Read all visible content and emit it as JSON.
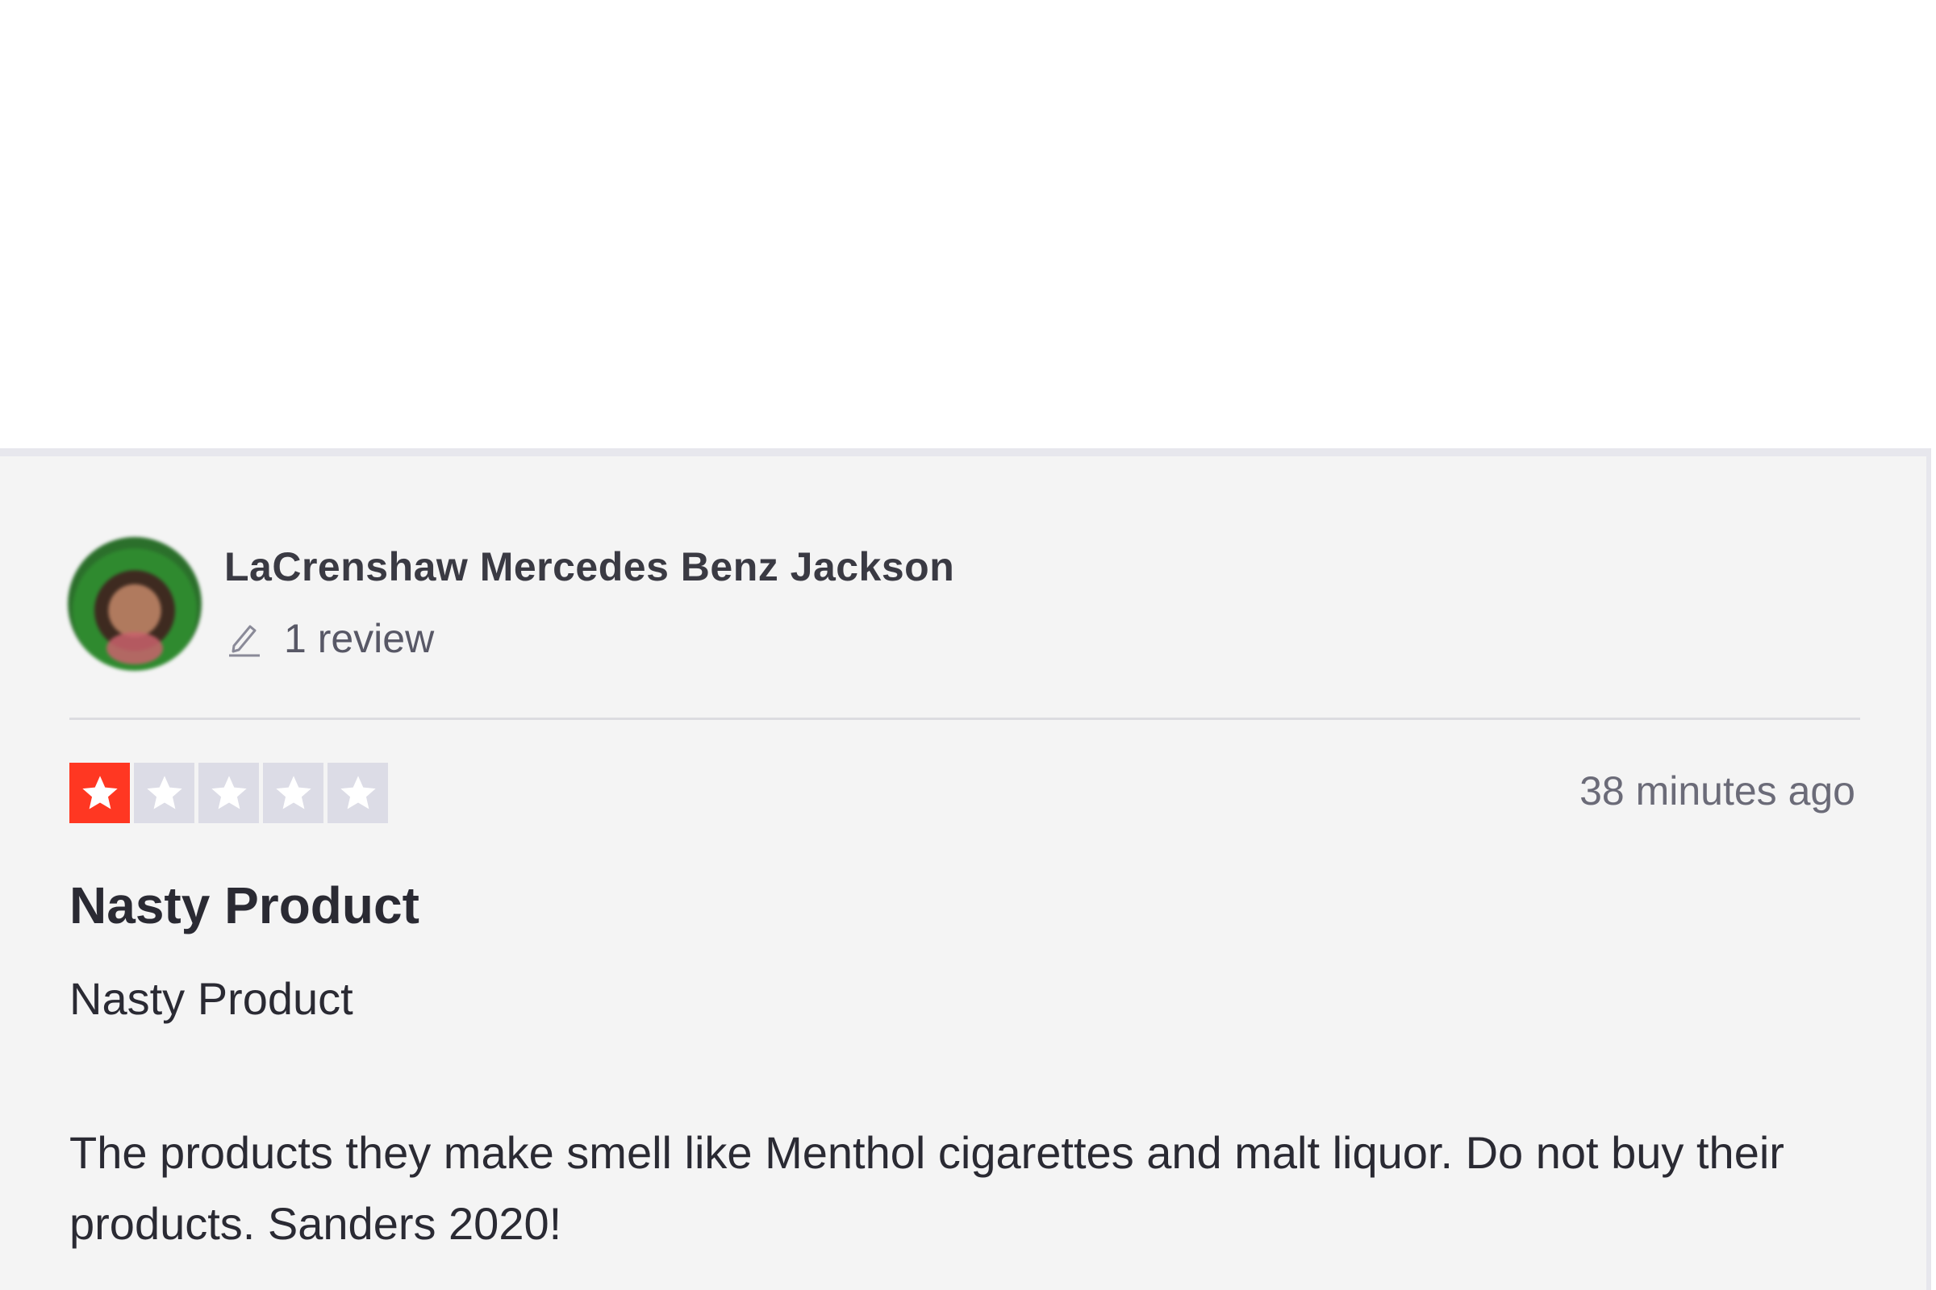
{
  "review": {
    "reviewer_name": "LaCrenshaw Mercedes Benz Jackson",
    "review_count": "1 review",
    "rating": 1,
    "rating_max": 5,
    "timestamp": "38 minutes ago",
    "title": "Nasty Product",
    "subtitle": "Nasty Product",
    "body": "The products they make smell like Menthol cigarettes and malt liquor. Do not buy their products. Sanders 2020!"
  },
  "icons": {
    "review_count_icon": "pencil-icon",
    "rating_icon": "star-icon"
  },
  "colors": {
    "star_filled": "#ff3722",
    "star_empty": "#dcdce6",
    "card_background": "#f4f4f4"
  }
}
